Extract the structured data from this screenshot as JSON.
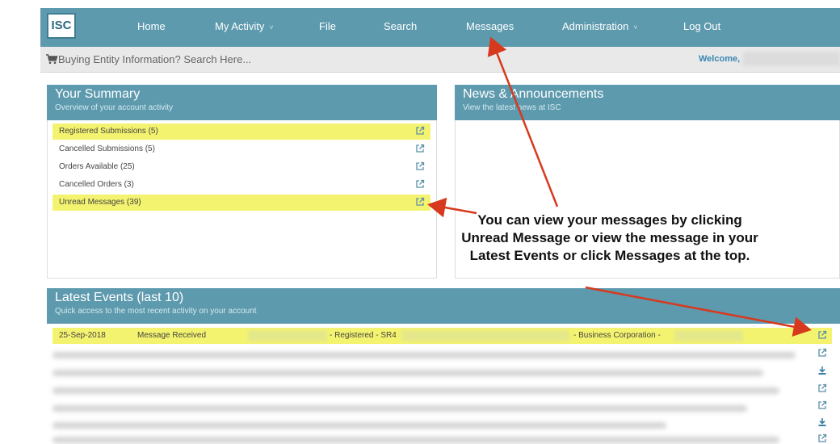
{
  "navbar": {
    "logo": "ISC",
    "items": [
      "Home",
      "My Activity",
      "File",
      "Search",
      "Messages",
      "Administration",
      "Log Out"
    ],
    "dropdown_caret": "˅"
  },
  "search_bar": {
    "text": "Buying Entity Information? Search Here...",
    "welcome": "Welcome,"
  },
  "summary": {
    "title": "Your Summary",
    "subtitle": "Overview of your account activity",
    "rows": [
      {
        "label": "Registered Submissions (5)",
        "highlight": true
      },
      {
        "label": "Cancelled Submissions (5)",
        "highlight": false
      },
      {
        "label": "Orders Available (25)",
        "highlight": false
      },
      {
        "label": "Cancelled Orders (3)",
        "highlight": false
      },
      {
        "label": "Unread Messages (39)",
        "highlight": true
      }
    ]
  },
  "news": {
    "title": "News & Announcements",
    "subtitle": "View the latest news at ISC"
  },
  "callout": {
    "text": "You can view your messages by clicking Unread Message or view the message in your Latest Events or click Messages at the top."
  },
  "events": {
    "title": "Latest Events (last 10)",
    "subtitle": "Quick access to the most recent activity on your account",
    "first_row": {
      "date": "25-Sep-2018",
      "type": "Message Received",
      "registered": "- Registered - SR4",
      "corporation": "- Business Corporation -"
    },
    "row_icons": [
      "external-link-icon",
      "external-link-icon",
      "download-icon",
      "external-link-icon",
      "external-link-icon",
      "download-icon",
      "external-link-icon"
    ]
  },
  "colors": {
    "header": "#5d9aae",
    "highlight": "#f4f36f",
    "arrow": "#d7391e",
    "icon": "#5b8fa8"
  }
}
